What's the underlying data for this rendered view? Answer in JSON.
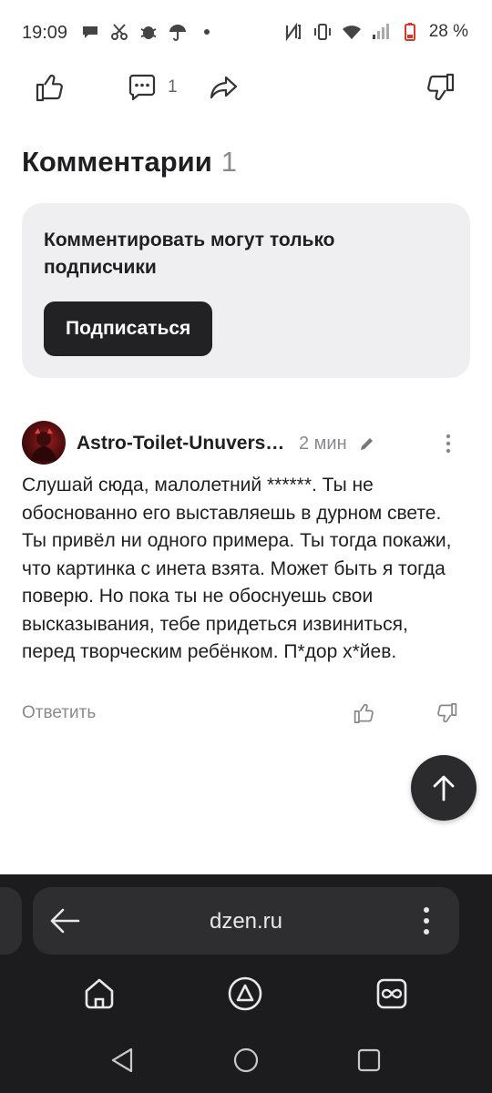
{
  "status_bar": {
    "time": "19:09",
    "battery_percent": "28 %",
    "left_icons": [
      "message-icon",
      "scissors-icon",
      "bug-icon",
      "umbrella-icon",
      "dot-icon"
    ],
    "right_icons": [
      "nfc-icon",
      "vibrate-icon",
      "wifi-icon",
      "signal-icon",
      "battery-icon"
    ]
  },
  "actions": {
    "comment_count": "1"
  },
  "comments": {
    "heading": "Комментарии",
    "count": "1"
  },
  "subscribe_card": {
    "text": "Комментировать могут только подписчики",
    "button_label": "Подписаться"
  },
  "comment": {
    "author": "Astro-Toilet-Unuversity",
    "time": "2 мин",
    "text": "Слушай сюда, малолетний ******. Ты не обоснованно его выставляешь в дурном свете. Ты привёл ни одного примера. Ты тогда покажи, что картинка с инета взята. Может быть я тогда поверю. Но пока ты не обоснуешь свои высказывания, тебе придеться извиниться, перед творческим ребёнком. П*дор х*йев.",
    "reply_label": "Ответить"
  },
  "browser": {
    "url": "dzen.ru"
  },
  "colors": {
    "card_bg": "#efeff2",
    "button_bg": "#222224",
    "browser_bg": "#1c1c1e",
    "muted_text": "#8a8a8e"
  }
}
